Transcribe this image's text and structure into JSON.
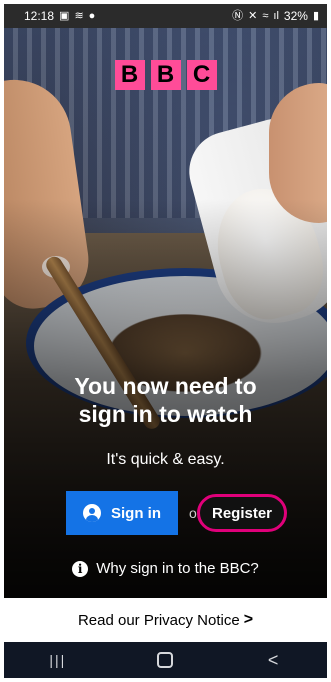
{
  "status_bar": {
    "time": "12:18",
    "battery": "32%",
    "left_icons": [
      "image-icon",
      "cast-icon",
      "spotify-icon"
    ],
    "right_icons": [
      "nfc-icon",
      "mute-icon",
      "wifi-icon",
      "signal-icon",
      "battery-icon"
    ]
  },
  "logo": {
    "letters": [
      "B",
      "B",
      "C"
    ],
    "color": "#ff4c98"
  },
  "main": {
    "headline_line1": "You now need to",
    "headline_line2": "sign in to watch",
    "subline": "It's quick & easy.",
    "signin_label": "Sign in",
    "or_label": "or",
    "register_label": "Register",
    "why_label": "Why sign in to the BBC?"
  },
  "footer": {
    "privacy_label": "Read our Privacy Notice"
  },
  "colors": {
    "signin": "#1473e6",
    "register_highlight": "#e0007a"
  },
  "nav": {
    "icons": [
      "recents-icon",
      "home-icon",
      "back-icon"
    ]
  }
}
